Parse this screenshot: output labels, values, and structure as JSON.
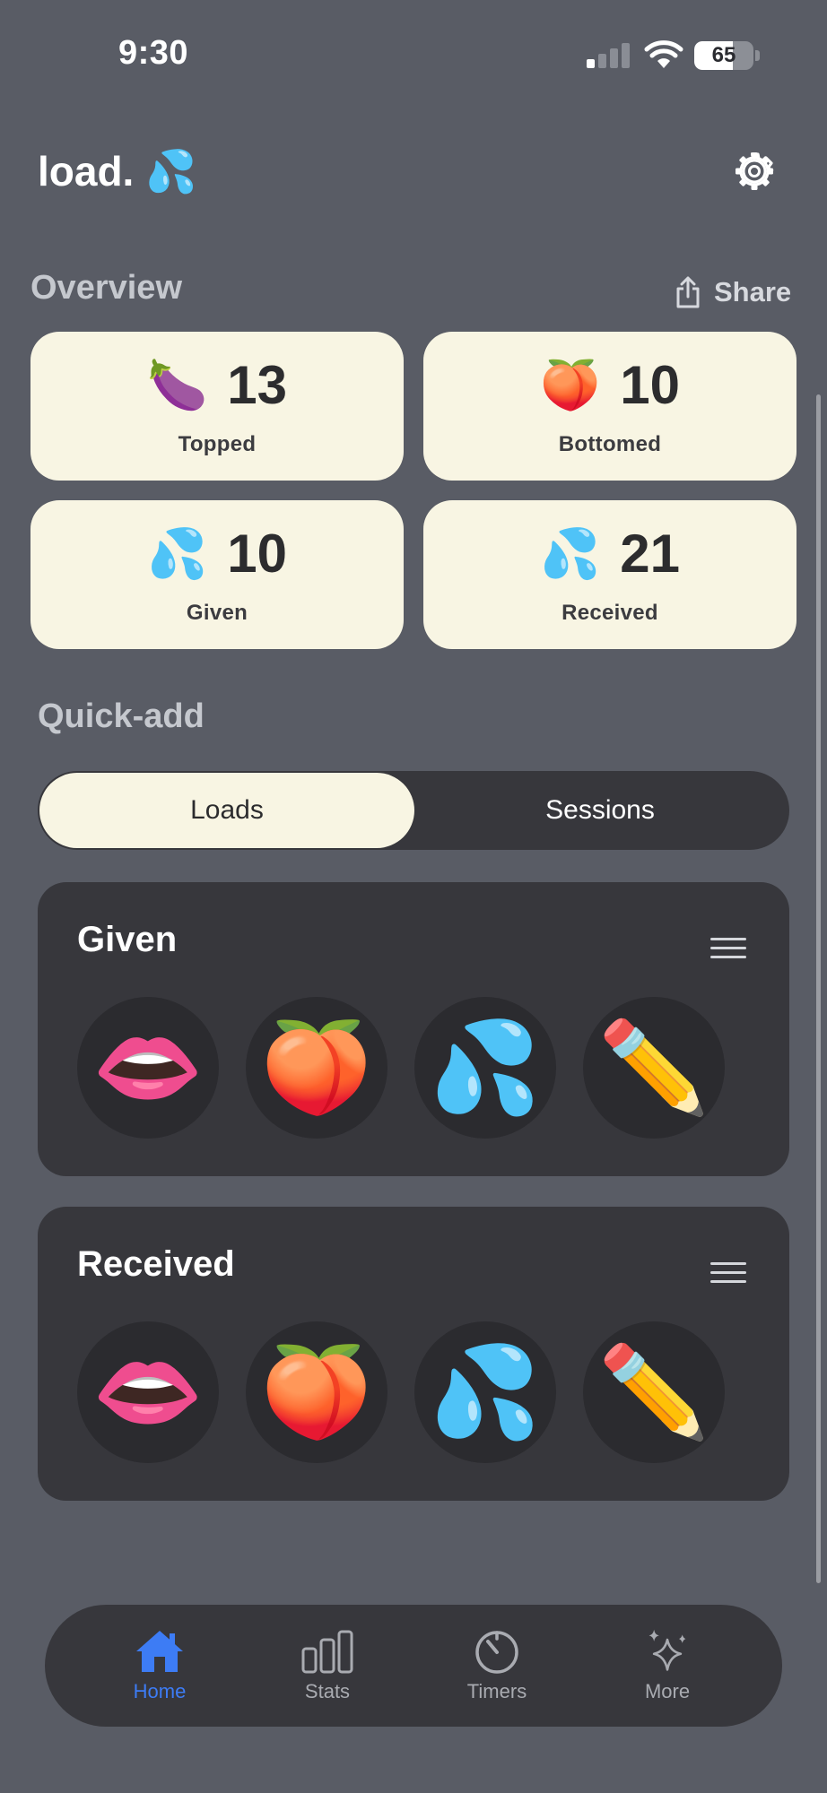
{
  "status_bar": {
    "time": "9:30",
    "battery": 65
  },
  "header": {
    "title": "load. 💦",
    "settings_icon": "gear-icon"
  },
  "overview": {
    "title": "Overview",
    "share_label": "Share",
    "cards": [
      {
        "emoji": "🍆",
        "value": "13",
        "label": "Topped"
      },
      {
        "emoji": "🍑",
        "value": "10",
        "label": "Bottomed"
      },
      {
        "emoji": "💦",
        "value": "10",
        "label": "Given"
      },
      {
        "emoji": "💦",
        "value": "21",
        "label": "Received"
      }
    ]
  },
  "quick_add": {
    "title": "Quick-add",
    "segments": [
      "Loads",
      "Sessions"
    ],
    "selected_segment": "Loads",
    "panels": [
      {
        "title": "Given",
        "buttons": [
          "👄",
          "🍑",
          "💦",
          "✏️"
        ]
      },
      {
        "title": "Received",
        "buttons": [
          "👄",
          "🍑",
          "💦",
          "✏️"
        ]
      }
    ]
  },
  "tabbar": {
    "tabs": [
      {
        "label": "Home",
        "icon": "house-icon",
        "active": true
      },
      {
        "label": "Stats",
        "icon": "bar-chart-icon",
        "active": false
      },
      {
        "label": "Timers",
        "icon": "timer-icon",
        "active": false
      },
      {
        "label": "More",
        "icon": "sparkles-icon",
        "active": false
      }
    ]
  },
  "colors": {
    "background": "#595c65",
    "card": "#f8f5e3",
    "panel": "#37373c",
    "accent": "#3d7cf5"
  }
}
